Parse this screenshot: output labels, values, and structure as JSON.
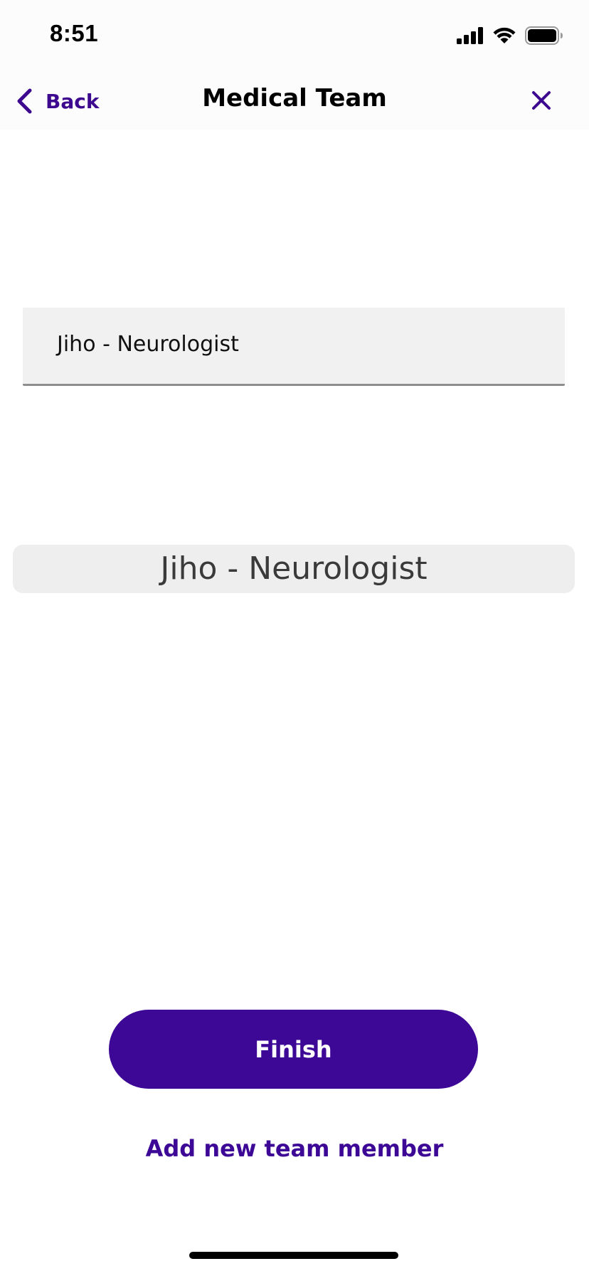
{
  "status_bar": {
    "time": "8:51",
    "icons": [
      "cellular-signal-icon",
      "wifi-icon",
      "battery-icon"
    ]
  },
  "nav": {
    "back_label": "Back",
    "title": "Medical Team",
    "back_icon": "chevron-left-icon",
    "close_icon": "close-icon"
  },
  "select_field": {
    "value": "Jiho  - Neurologist"
  },
  "picker": {
    "selected": "Jiho  - Neurologist"
  },
  "actions": {
    "finish_label": "Finish",
    "add_member_label": "Add new team member"
  },
  "colors": {
    "accent": "#3d0896",
    "field_background": "#f1f1f1",
    "picker_background": "#eeeeee"
  }
}
